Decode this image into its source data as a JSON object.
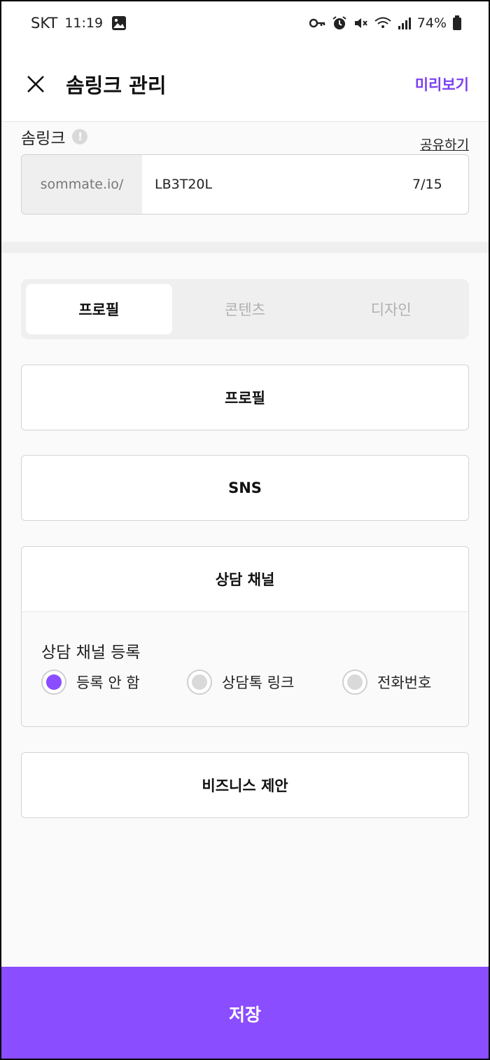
{
  "status_bar": {
    "carrier": "SKT",
    "time": "11:19",
    "battery": "74%",
    "icons": [
      "gallery-icon",
      "key-icon",
      "alarm-icon",
      "mute-icon",
      "wifi-icon",
      "signal-icon",
      "battery-icon"
    ]
  },
  "header": {
    "title": "솜링크 관리",
    "preview_label": "미리보기",
    "close_icon": "close-icon"
  },
  "link": {
    "label": "솜링크",
    "share_label": "공유하기",
    "prefix": "sommate.io/",
    "value": "LB3T20L",
    "counter": "7/15"
  },
  "tabs": [
    {
      "label": "프로필",
      "active": true
    },
    {
      "label": "콘텐츠",
      "active": false
    },
    {
      "label": "디자인",
      "active": false
    }
  ],
  "sections": {
    "profile": "프로필",
    "sns": "SNS",
    "consult": {
      "title": "상담 채널",
      "register_label": "상담 채널 등록",
      "options": [
        {
          "label": "등록 안 함",
          "selected": true
        },
        {
          "label": "상담톡 링크",
          "selected": false
        },
        {
          "label": "전화번호",
          "selected": false
        }
      ]
    },
    "business": "비즈니스 제안"
  },
  "colors": {
    "accent": "#8a4dff",
    "preview_text": "#7b3ff2"
  },
  "save_label": "저장"
}
